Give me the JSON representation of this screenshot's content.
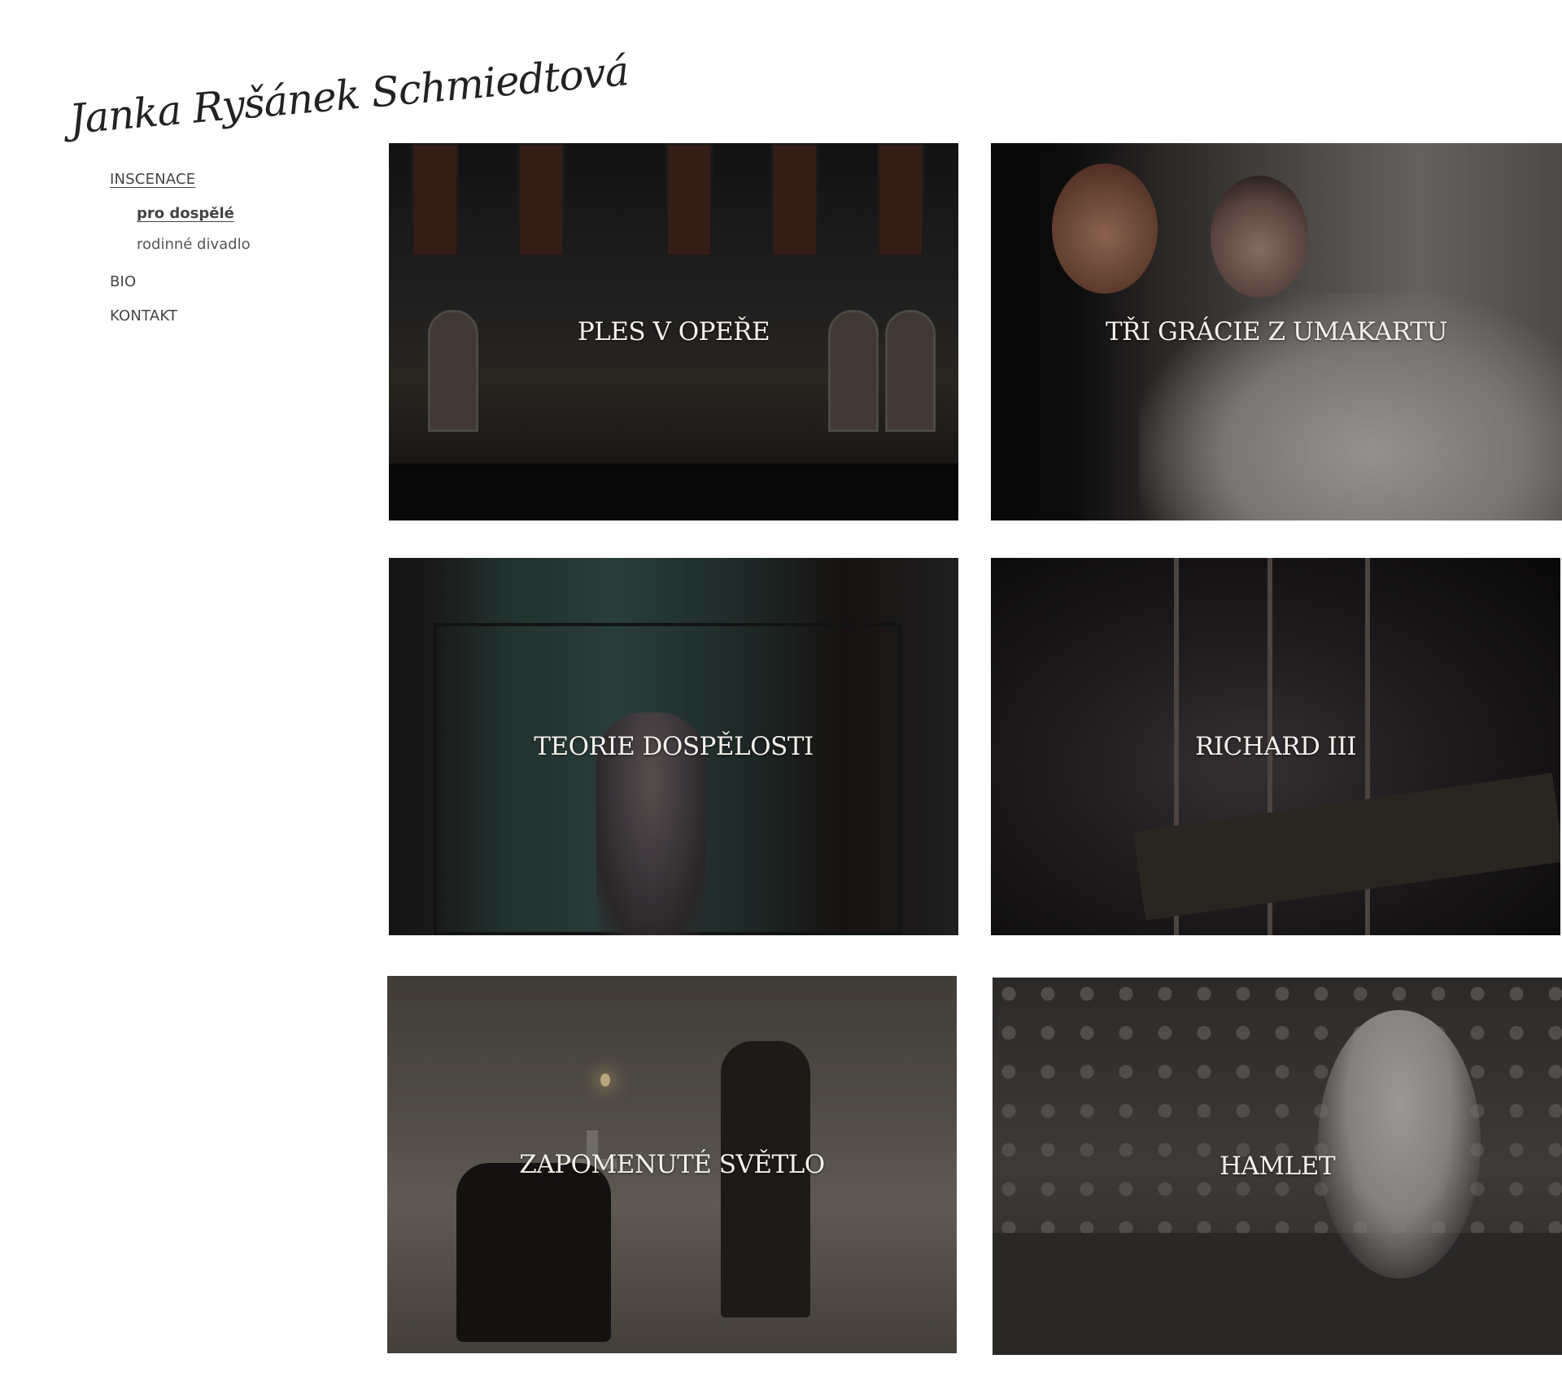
{
  "site": {
    "logo_text": "Janka Ryšánek Schmiedtová"
  },
  "nav": {
    "items": [
      {
        "label": "INSCENACE",
        "active": true
      },
      {
        "label": "pro dospělé",
        "active": true
      },
      {
        "label": "rodinné divadlo",
        "active": false
      },
      {
        "label": "BIO",
        "active": false
      },
      {
        "label": "KONTAKT",
        "active": false
      }
    ]
  },
  "productions": [
    {
      "title": "PLES V OPEŘE"
    },
    {
      "title": "TŘI GRÁCIE Z UMAKARTU"
    },
    {
      "title": "TEORIE DOSPĚLOSTI"
    },
    {
      "title": "RICHARD III"
    },
    {
      "title": "ZAPOMENUTÉ SVĚTLO"
    },
    {
      "title": "HAMLET"
    }
  ]
}
